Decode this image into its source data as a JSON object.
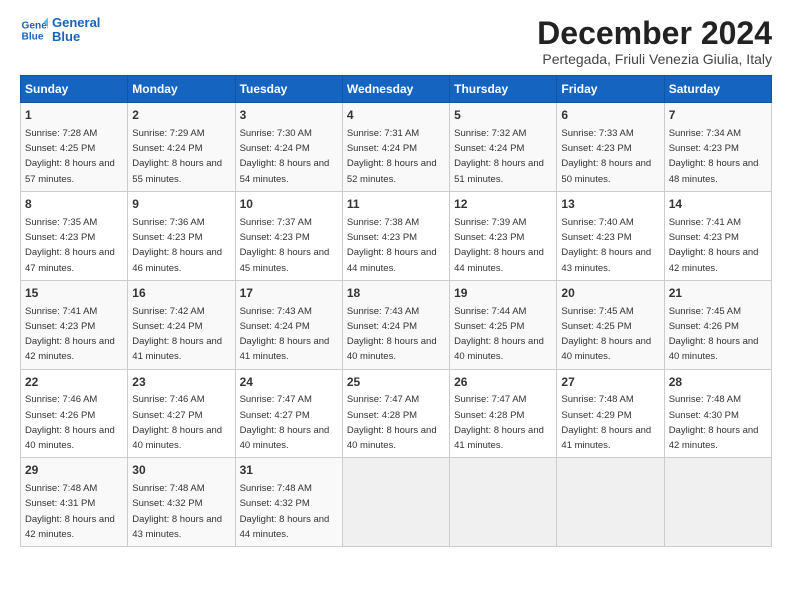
{
  "header": {
    "logo_line1": "General",
    "logo_line2": "Blue",
    "main_title": "December 2024",
    "subtitle": "Pertegada, Friuli Venezia Giulia, Italy"
  },
  "days_of_week": [
    "Sunday",
    "Monday",
    "Tuesday",
    "Wednesday",
    "Thursday",
    "Friday",
    "Saturday"
  ],
  "weeks": [
    [
      {
        "day": "1",
        "sunrise": "7:28 AM",
        "sunset": "4:25 PM",
        "daylight": "8 hours and 57 minutes."
      },
      {
        "day": "2",
        "sunrise": "7:29 AM",
        "sunset": "4:24 PM",
        "daylight": "8 hours and 55 minutes."
      },
      {
        "day": "3",
        "sunrise": "7:30 AM",
        "sunset": "4:24 PM",
        "daylight": "8 hours and 54 minutes."
      },
      {
        "day": "4",
        "sunrise": "7:31 AM",
        "sunset": "4:24 PM",
        "daylight": "8 hours and 52 minutes."
      },
      {
        "day": "5",
        "sunrise": "7:32 AM",
        "sunset": "4:24 PM",
        "daylight": "8 hours and 51 minutes."
      },
      {
        "day": "6",
        "sunrise": "7:33 AM",
        "sunset": "4:23 PM",
        "daylight": "8 hours and 50 minutes."
      },
      {
        "day": "7",
        "sunrise": "7:34 AM",
        "sunset": "4:23 PM",
        "daylight": "8 hours and 48 minutes."
      }
    ],
    [
      {
        "day": "8",
        "sunrise": "7:35 AM",
        "sunset": "4:23 PM",
        "daylight": "8 hours and 47 minutes."
      },
      {
        "day": "9",
        "sunrise": "7:36 AM",
        "sunset": "4:23 PM",
        "daylight": "8 hours and 46 minutes."
      },
      {
        "day": "10",
        "sunrise": "7:37 AM",
        "sunset": "4:23 PM",
        "daylight": "8 hours and 45 minutes."
      },
      {
        "day": "11",
        "sunrise": "7:38 AM",
        "sunset": "4:23 PM",
        "daylight": "8 hours and 44 minutes."
      },
      {
        "day": "12",
        "sunrise": "7:39 AM",
        "sunset": "4:23 PM",
        "daylight": "8 hours and 44 minutes."
      },
      {
        "day": "13",
        "sunrise": "7:40 AM",
        "sunset": "4:23 PM",
        "daylight": "8 hours and 43 minutes."
      },
      {
        "day": "14",
        "sunrise": "7:41 AM",
        "sunset": "4:23 PM",
        "daylight": "8 hours and 42 minutes."
      }
    ],
    [
      {
        "day": "15",
        "sunrise": "7:41 AM",
        "sunset": "4:23 PM",
        "daylight": "8 hours and 42 minutes."
      },
      {
        "day": "16",
        "sunrise": "7:42 AM",
        "sunset": "4:24 PM",
        "daylight": "8 hours and 41 minutes."
      },
      {
        "day": "17",
        "sunrise": "7:43 AM",
        "sunset": "4:24 PM",
        "daylight": "8 hours and 41 minutes."
      },
      {
        "day": "18",
        "sunrise": "7:43 AM",
        "sunset": "4:24 PM",
        "daylight": "8 hours and 40 minutes."
      },
      {
        "day": "19",
        "sunrise": "7:44 AM",
        "sunset": "4:25 PM",
        "daylight": "8 hours and 40 minutes."
      },
      {
        "day": "20",
        "sunrise": "7:45 AM",
        "sunset": "4:25 PM",
        "daylight": "8 hours and 40 minutes."
      },
      {
        "day": "21",
        "sunrise": "7:45 AM",
        "sunset": "4:26 PM",
        "daylight": "8 hours and 40 minutes."
      }
    ],
    [
      {
        "day": "22",
        "sunrise": "7:46 AM",
        "sunset": "4:26 PM",
        "daylight": "8 hours and 40 minutes."
      },
      {
        "day": "23",
        "sunrise": "7:46 AM",
        "sunset": "4:27 PM",
        "daylight": "8 hours and 40 minutes."
      },
      {
        "day": "24",
        "sunrise": "7:47 AM",
        "sunset": "4:27 PM",
        "daylight": "8 hours and 40 minutes."
      },
      {
        "day": "25",
        "sunrise": "7:47 AM",
        "sunset": "4:28 PM",
        "daylight": "8 hours and 40 minutes."
      },
      {
        "day": "26",
        "sunrise": "7:47 AM",
        "sunset": "4:28 PM",
        "daylight": "8 hours and 41 minutes."
      },
      {
        "day": "27",
        "sunrise": "7:48 AM",
        "sunset": "4:29 PM",
        "daylight": "8 hours and 41 minutes."
      },
      {
        "day": "28",
        "sunrise": "7:48 AM",
        "sunset": "4:30 PM",
        "daylight": "8 hours and 42 minutes."
      }
    ],
    [
      {
        "day": "29",
        "sunrise": "7:48 AM",
        "sunset": "4:31 PM",
        "daylight": "8 hours and 42 minutes."
      },
      {
        "day": "30",
        "sunrise": "7:48 AM",
        "sunset": "4:32 PM",
        "daylight": "8 hours and 43 minutes."
      },
      {
        "day": "31",
        "sunrise": "7:48 AM",
        "sunset": "4:32 PM",
        "daylight": "8 hours and 44 minutes."
      },
      null,
      null,
      null,
      null
    ]
  ]
}
